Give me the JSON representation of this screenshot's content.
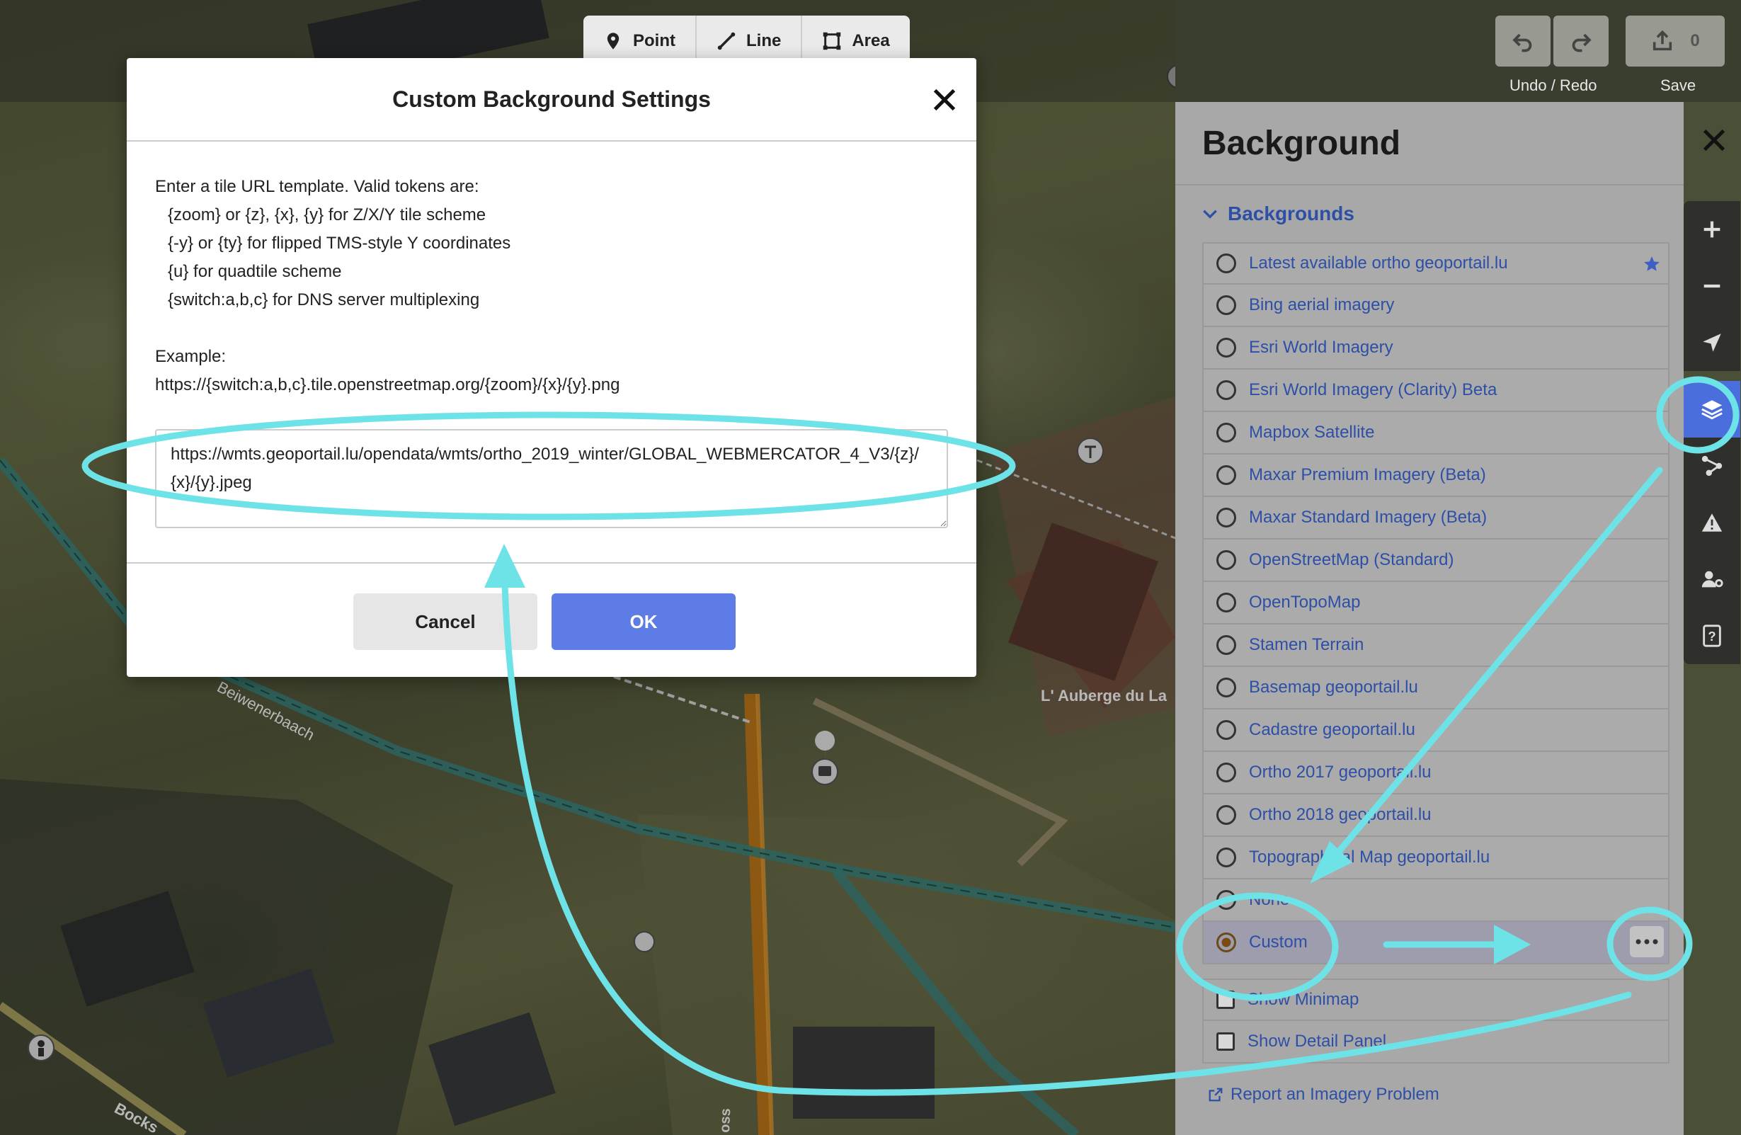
{
  "toolbar": {
    "modes": [
      {
        "label": "Point",
        "icon": "point-icon"
      },
      {
        "label": "Line",
        "icon": "line-icon"
      },
      {
        "label": "Area",
        "icon": "area-icon"
      }
    ],
    "undo_redo_label": "Undo / Redo",
    "save_label": "Save",
    "save_count": "0"
  },
  "modal": {
    "title": "Custom Background Settings",
    "intro": "Enter a tile URL template. Valid tokens are:",
    "tokens": [
      "{zoom} or {z}, {x}, {y} for Z/X/Y tile scheme",
      "{-y} or {ty} for flipped TMS-style Y coordinates",
      "{u} for quadtile scheme",
      "{switch:a,b,c} for DNS server multiplexing"
    ],
    "example_label": "Example:",
    "example_url": "https://{switch:a,b,c}.tile.openstreetmap.org/{zoom}/{x}/{y}.png",
    "url_value": "https://wmts.geoportail.lu/opendata/wmts/ortho_2019_winter/GLOBAL_WEBMERCATOR_4_V3/{z}/{x}/{y}.jpeg",
    "cancel_label": "Cancel",
    "ok_label": "OK"
  },
  "panel": {
    "title": "Background",
    "section_title": "Backgrounds",
    "items": [
      {
        "label": "Latest available ortho geoportail.lu",
        "selected": false,
        "starred": true
      },
      {
        "label": "Bing aerial imagery",
        "selected": false
      },
      {
        "label": "Esri World Imagery",
        "selected": false
      },
      {
        "label": "Esri World Imagery (Clarity) Beta",
        "selected": false
      },
      {
        "label": "Mapbox Satellite",
        "selected": false
      },
      {
        "label": "Maxar Premium Imagery (Beta)",
        "selected": false
      },
      {
        "label": "Maxar Standard Imagery (Beta)",
        "selected": false
      },
      {
        "label": "OpenStreetMap (Standard)",
        "selected": false
      },
      {
        "label": "OpenTopoMap",
        "selected": false
      },
      {
        "label": "Stamen Terrain",
        "selected": false
      },
      {
        "label": "Basemap geoportail.lu",
        "selected": false
      },
      {
        "label": "Cadastre geoportail.lu",
        "selected": false
      },
      {
        "label": "Ortho 2017 geoportail.lu",
        "selected": false
      },
      {
        "label": "Ortho 2018 geoportail.lu",
        "selected": false
      },
      {
        "label": "Topographical Map geoportail.lu",
        "selected": false
      },
      {
        "label": "None",
        "selected": false
      },
      {
        "label": "Custom",
        "selected": true
      }
    ],
    "options": [
      {
        "label": "Show Minimap"
      },
      {
        "label": "Show Detail Panel"
      }
    ],
    "report_label": "Report an Imagery Problem"
  },
  "map": {
    "labels": [
      "Beiwenerbaach",
      "L' Auberge du La",
      "Bocks",
      "oss"
    ]
  },
  "colors": {
    "accent": "#5d7ce6",
    "annotation": "#6de3e8",
    "link": "#2d4fa6"
  }
}
